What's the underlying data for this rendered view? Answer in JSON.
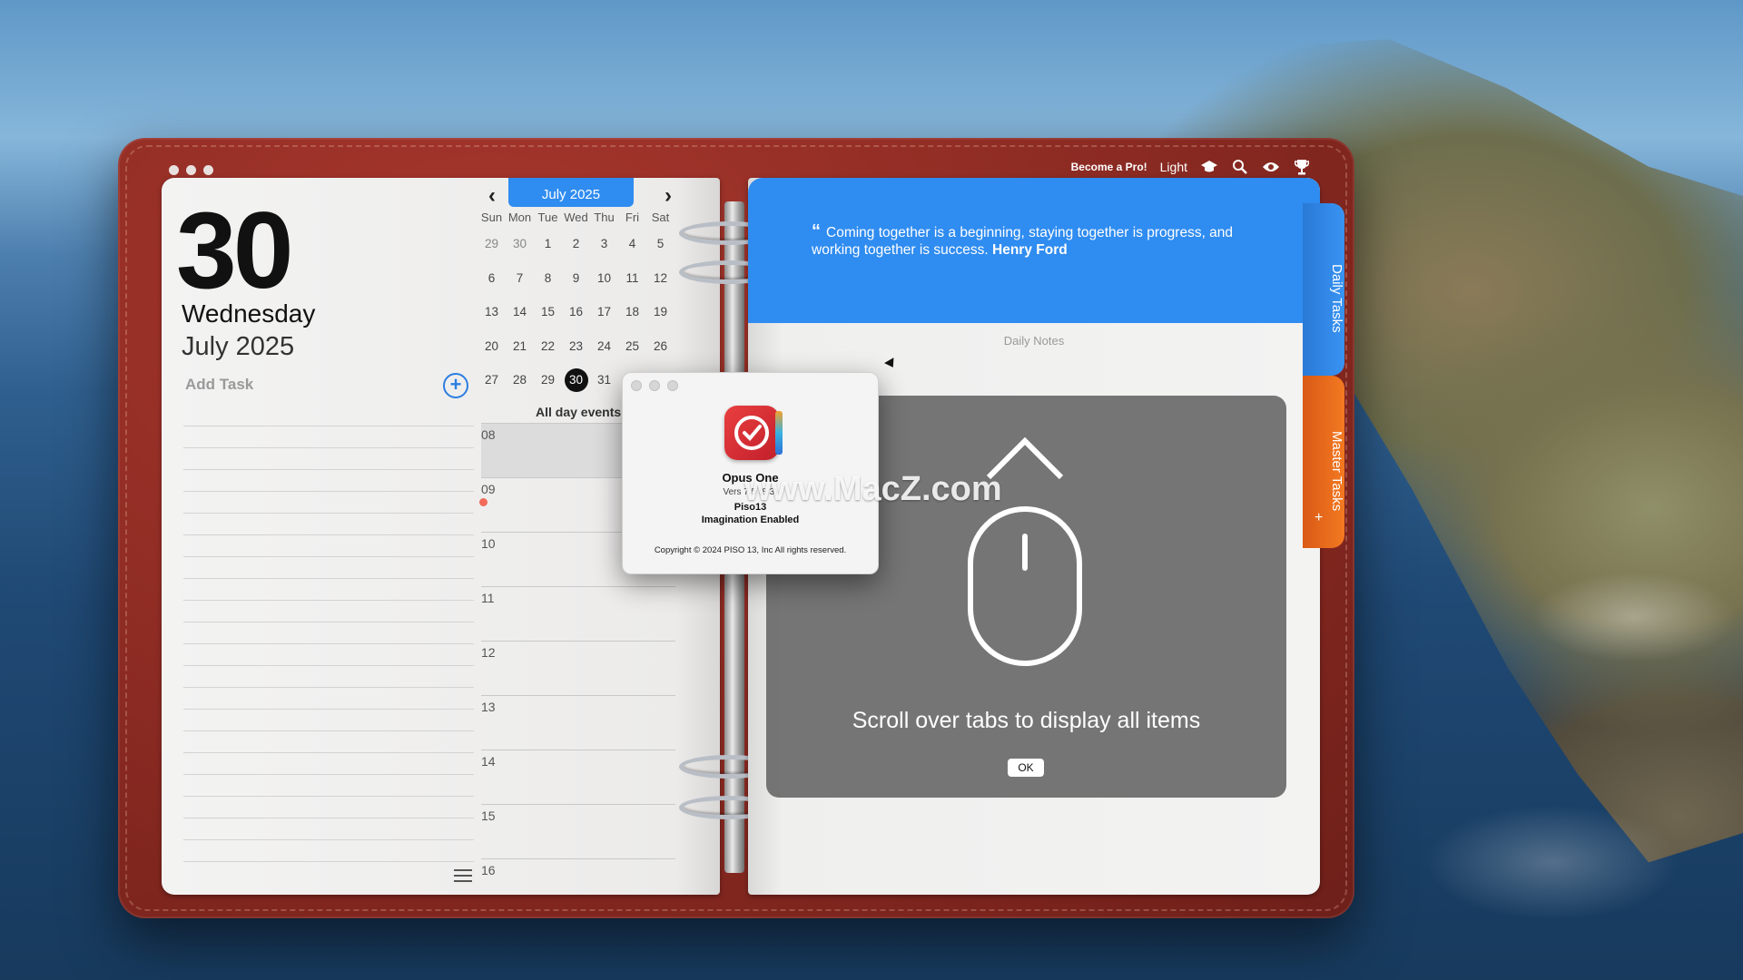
{
  "colors": {
    "accent_blue": "#2f8cf0",
    "binder_red": "#8a2a22",
    "tab_orange": "#f37921"
  },
  "window": {
    "traffic_lights": [
      "close",
      "minimize",
      "zoom"
    ]
  },
  "topbar": {
    "pro_label": "Become a Pro!",
    "theme_label": "Light",
    "icons": [
      "graduation-cap-icon",
      "search-icon",
      "eye-icon",
      "trophy-icon"
    ]
  },
  "day": {
    "number": "30",
    "weekday": "Wednesday",
    "month_year": "July 2025"
  },
  "tasks": {
    "add_placeholder": "Add Task",
    "add_button": "+"
  },
  "calendar": {
    "month_label": "July 2025",
    "prev": "‹",
    "next": "›",
    "weekdays": [
      "Sun",
      "Mon",
      "Tue",
      "Wed",
      "Thu",
      "Fri",
      "Sat"
    ],
    "days": [
      "29",
      "30",
      "1",
      "2",
      "3",
      "4",
      "5",
      "6",
      "7",
      "8",
      "9",
      "10",
      "11",
      "12",
      "13",
      "14",
      "15",
      "16",
      "17",
      "18",
      "19",
      "20",
      "21",
      "22",
      "23",
      "24",
      "25",
      "26",
      "27",
      "28",
      "29",
      "30",
      "31"
    ],
    "selected": "30"
  },
  "schedule": {
    "all_day_label": "All day events",
    "hours": [
      "08",
      "09",
      "10",
      "11",
      "12",
      "13",
      "14",
      "15",
      "16"
    ]
  },
  "quote": {
    "text": "Coming together is a beginning, staying together is progress, and working together is success.",
    "author": "Henry Ford"
  },
  "notes": {
    "label": "Daily Notes"
  },
  "tabs": {
    "daily": "Daily Tasks",
    "master": "Master Tasks",
    "add": "+"
  },
  "tip": {
    "text": "Scroll over tabs to display all items",
    "ok": "OK"
  },
  "about": {
    "app_name": "Opus One",
    "version": "Vers 7.5 (8 3)",
    "company": "Piso13",
    "slogan": "Imagination Enabled",
    "copyright": "Copyright © 2024 PISO 13, Inc All rights reserved."
  },
  "watermark": "www.MacZ.com"
}
